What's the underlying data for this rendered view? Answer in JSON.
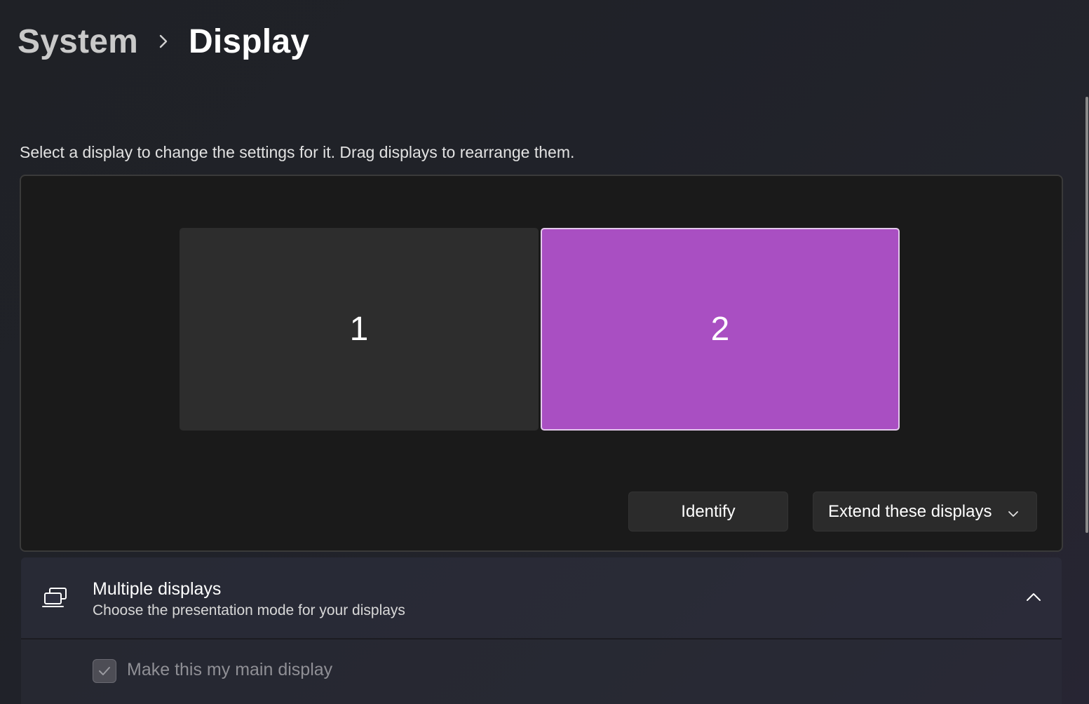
{
  "breadcrumb": {
    "parent": "System",
    "separator_icon": "chevron-right-icon",
    "current": "Display"
  },
  "instruction": "Select a display to change the settings for it. Drag displays to rearrange them.",
  "monitors": [
    {
      "label": "1",
      "selected": false,
      "color": "#2d2d2d"
    },
    {
      "label": "2",
      "selected": true,
      "color": "#a94fc2"
    }
  ],
  "buttons": {
    "identify": "Identify",
    "mode_select": {
      "value": "Extend these displays",
      "icon": "chevron-down-icon"
    }
  },
  "multiple_displays": {
    "icon": "multiple-displays-icon",
    "title": "Multiple displays",
    "subtitle": "Choose the presentation mode for your displays",
    "toggle_icon": "chevron-up-icon",
    "expanded": true
  },
  "main_display": {
    "label": "Make this my main display",
    "checked": true,
    "disabled": true
  },
  "colors": {
    "accent": "#a94fc2",
    "background": "#202229",
    "panel": "#1a1a1a"
  }
}
